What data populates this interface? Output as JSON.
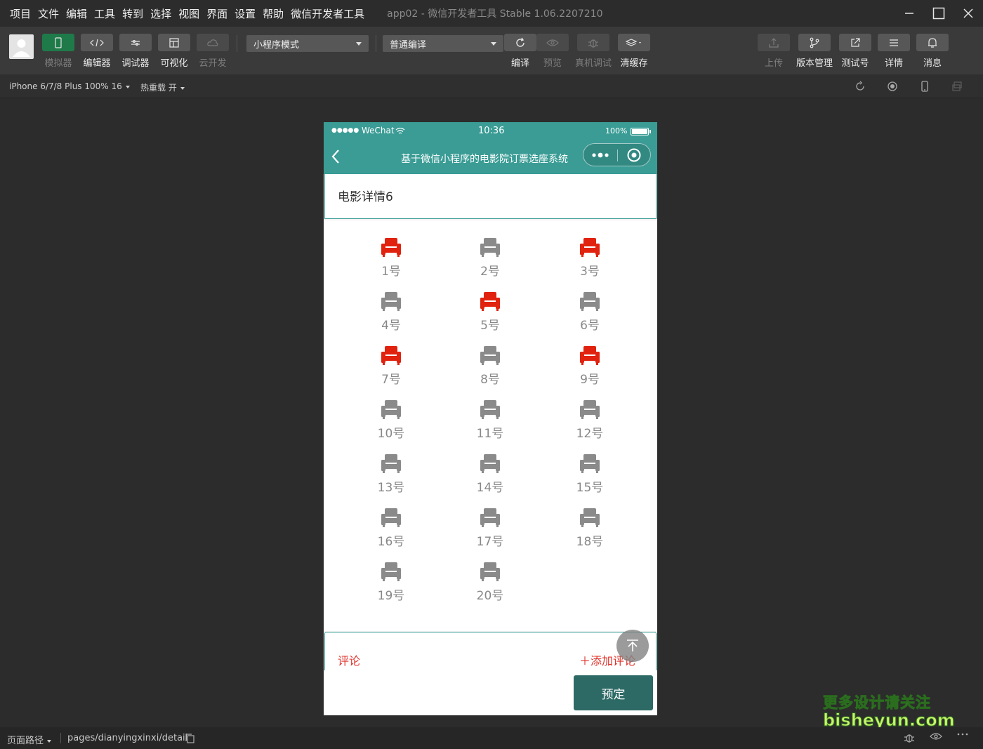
{
  "menu": {
    "items": [
      "项目",
      "文件",
      "编辑",
      "工具",
      "转到",
      "选择",
      "视图",
      "界面",
      "设置",
      "帮助",
      "微信开发者工具"
    ],
    "app_title": "app02 - 微信开发者工具 Stable 1.06.2207210"
  },
  "toolbar": {
    "left_buttons": [
      {
        "label": "模拟器",
        "icon": "phone-icon",
        "state": "active"
      },
      {
        "label": "编辑器",
        "icon": "code-icon",
        "state": "normal"
      },
      {
        "label": "调试器",
        "icon": "debug-icon",
        "state": "normal"
      },
      {
        "label": "可视化",
        "icon": "layout-icon",
        "state": "normal"
      },
      {
        "label": "云开发",
        "icon": "cloud-icon",
        "state": "disabled"
      }
    ],
    "mode_select": "小程序模式",
    "compile_select": "普通编译",
    "mid_buttons": [
      {
        "label": "编译",
        "icon": "refresh-icon",
        "state": "normal"
      },
      {
        "label": "预览",
        "icon": "eye-icon",
        "state": "disabled"
      },
      {
        "label": "真机调试",
        "icon": "bug-icon",
        "state": "disabled"
      },
      {
        "label": "清缓存",
        "icon": "layers-icon",
        "state": "normal"
      }
    ],
    "right_buttons": [
      {
        "label": "上传",
        "icon": "upload-icon",
        "state": "disabled"
      },
      {
        "label": "版本管理",
        "icon": "branch-icon",
        "state": "normal"
      },
      {
        "label": "测试号",
        "icon": "external-link-icon",
        "state": "normal"
      },
      {
        "label": "详情",
        "icon": "menu-icon",
        "state": "normal"
      },
      {
        "label": "消息",
        "icon": "bell-icon",
        "state": "normal"
      }
    ]
  },
  "subbar": {
    "device": "iPhone 6/7/8 Plus 100% 16",
    "hot_reload": "热重载 开"
  },
  "phone": {
    "status": {
      "dots": "●●●●●",
      "carrier": "WeChat",
      "time": "10:36",
      "battery": "100%"
    },
    "nav_title": "基于微信小程序的电影院订票选座系统",
    "detail_title": "电影详情6",
    "seats": [
      {
        "label": "1号",
        "sold": true
      },
      {
        "label": "2号",
        "sold": false
      },
      {
        "label": "3号",
        "sold": true
      },
      {
        "label": "4号",
        "sold": false
      },
      {
        "label": "5号",
        "sold": true
      },
      {
        "label": "6号",
        "sold": false
      },
      {
        "label": "7号",
        "sold": true
      },
      {
        "label": "8号",
        "sold": false
      },
      {
        "label": "9号",
        "sold": true
      },
      {
        "label": "10号",
        "sold": false
      },
      {
        "label": "11号",
        "sold": false
      },
      {
        "label": "12号",
        "sold": false
      },
      {
        "label": "13号",
        "sold": false
      },
      {
        "label": "14号",
        "sold": false
      },
      {
        "label": "15号",
        "sold": false
      },
      {
        "label": "16号",
        "sold": false
      },
      {
        "label": "17号",
        "sold": false
      },
      {
        "label": "18号",
        "sold": false
      },
      {
        "label": "19号",
        "sold": false
      },
      {
        "label": "20号",
        "sold": false
      }
    ],
    "comment_label": "评论",
    "add_comment": "＋添加评论",
    "book_button": "预定"
  },
  "watermark": {
    "line1": "更多设计请关注",
    "line2": "bisheyun.com"
  },
  "footer": {
    "path_label": "页面路径",
    "path_value": "pages/dianyingxinxi/detail"
  },
  "colors": {
    "accent_teal": "#3a9c95",
    "book_button": "#2d6a66",
    "seat_sold": "#e0220f",
    "seat_free": "#8a8a8a",
    "comment_red": "#e0322a",
    "toolbar_active": "#1f7a4a"
  }
}
